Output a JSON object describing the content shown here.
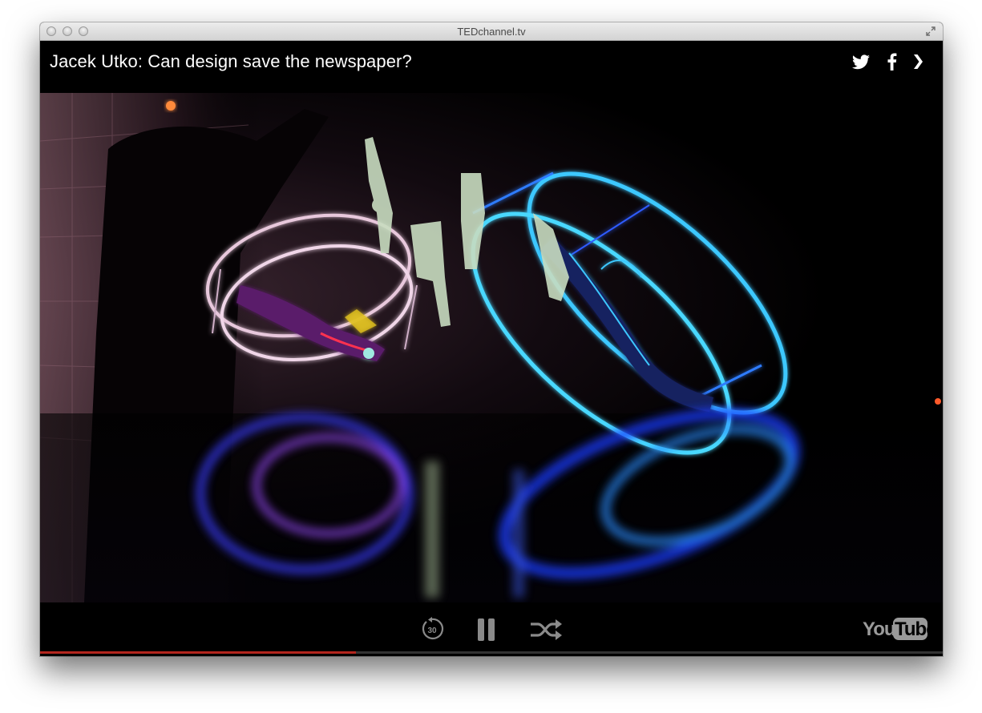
{
  "window": {
    "title": "TEDchannel.tv"
  },
  "video": {
    "title": "Jacek Utko: Can design save the newspaper?",
    "progress_fraction": 0.35
  },
  "controls": {
    "rewind_label": "30",
    "brand_you": "You",
    "brand_tube": "Tube"
  },
  "colors": {
    "progress": "#b3261e",
    "background": "#000000"
  },
  "icons": [
    "twitter-icon",
    "facebook-icon",
    "next-icon",
    "rewind-30-icon",
    "pause-icon",
    "shuffle-icon",
    "youtube-logo"
  ]
}
